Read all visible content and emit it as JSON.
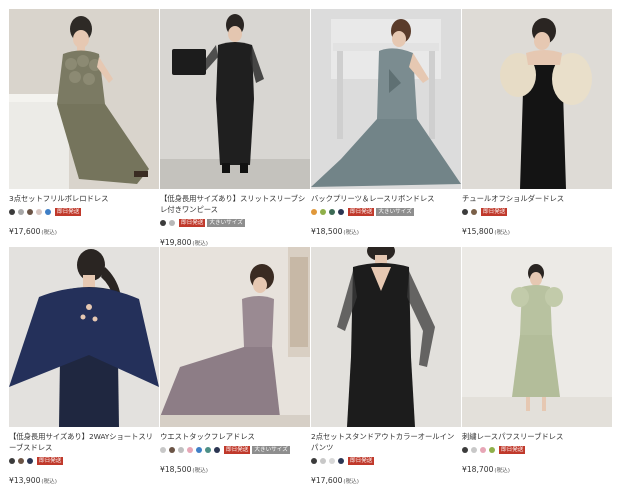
{
  "products": [
    {
      "title": "3点セットフリルボレロドレス",
      "colors": [
        "#3b3b3b",
        "#a8a8a8",
        "#6b5446",
        "#d9c7c2",
        "#3f7fc6"
      ],
      "badges": [
        "即日発送"
      ],
      "price": "¥17,600",
      "tax": "(税込)"
    },
    {
      "title": "【低身長用サイズあり】スリットスリーブシレ付きワンピース",
      "colors": [
        "#3b3b3b",
        "#b8b8b8"
      ],
      "badges": [
        "即日発送",
        "大きいサイズ"
      ],
      "price": "¥19,800",
      "tax": "(税込)"
    },
    {
      "title": "バックプリーツ＆レースリボンドレス",
      "colors": [
        "#e0983a",
        "#8fb04a",
        "#3c6a54",
        "#2b3552"
      ],
      "badges": [
        "即日発送",
        "大きいサイズ"
      ],
      "price": "¥18,500",
      "tax": "(税込)"
    },
    {
      "title": "チュールオフショルダードレス",
      "colors": [
        "#3b3b3b",
        "#7a6048"
      ],
      "badges": [
        "即日発送"
      ],
      "price": "¥15,800",
      "tax": "(税込)"
    },
    {
      "title": "【低身長用サイズあり】2WAYショートスリーブスドレス",
      "colors": [
        "#3b3b3b",
        "#6b5446",
        "#2b3552"
      ],
      "badges": [
        "即日発送"
      ],
      "price": "¥13,900",
      "tax": "(税込)"
    },
    {
      "title": "ウエストタックフレアドレス",
      "colors": [
        "#c8c8c8",
        "#6b5446",
        "#bfbfbf",
        "#e7a6b6",
        "#3f7fc6",
        "#4c8f86",
        "#2b3552"
      ],
      "badges": [
        "即日発送",
        "大きいサイズ"
      ],
      "price": "¥18,500",
      "tax": "(税込)"
    },
    {
      "title": "2点セットスタンドアウトカラーオールインパンツ",
      "colors": [
        "#3b3b3b",
        "#c8c8c8",
        "#d8d8d8",
        "#2b3552"
      ],
      "badges": [
        "即日発送"
      ],
      "price": "¥17,600",
      "tax": "(税込)"
    },
    {
      "title": "刺繍レースパフスリーブドレス",
      "colors": [
        "#3b3b3b",
        "#c8c8c8",
        "#e7a6b6",
        "#8fb04a"
      ],
      "badges": [
        "即日発送"
      ],
      "price": "¥18,700",
      "tax": "(税込)"
    }
  ]
}
